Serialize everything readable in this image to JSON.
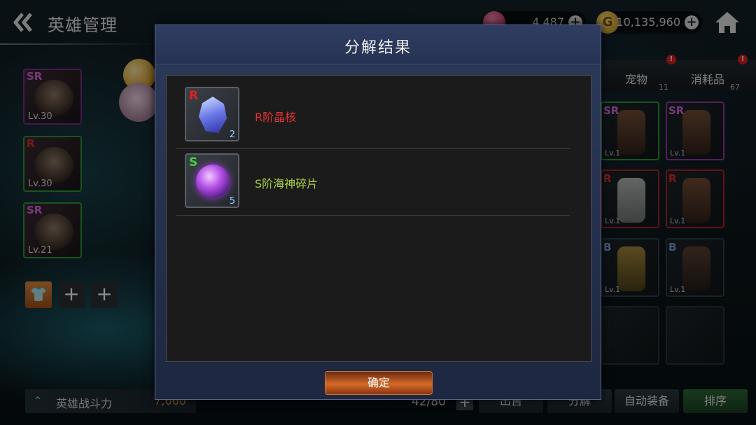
{
  "header": {
    "title": "英雄管理",
    "gems": "4,487",
    "gold": "10,135,960",
    "gold_icon_letter": "G"
  },
  "left_panel": {
    "heroes": [
      {
        "rarity": "SR",
        "level": "Lv.30"
      },
      {
        "rarity": "R",
        "level": "Lv.30"
      },
      {
        "rarity": "SR",
        "level": "Lv.21"
      }
    ],
    "equip_buttons": [
      "👕",
      "+",
      "+"
    ]
  },
  "inventory": {
    "tabs": [
      {
        "label": "宠物",
        "count": "11"
      },
      {
        "label": "消耗品",
        "count": "67"
      }
    ],
    "alert": "!",
    "items": [
      {
        "rarity": "SR",
        "level": "Lv.1"
      },
      {
        "rarity": "SR",
        "level": "Lv.1"
      },
      {
        "rarity": "R",
        "level": "Lv.1"
      },
      {
        "rarity": "R",
        "level": "Lv.1"
      },
      {
        "rarity": "B",
        "level": "Lv.1"
      },
      {
        "rarity": "B",
        "level": "Lv.1"
      }
    ]
  },
  "bottom_bar": {
    "power_label": "英雄战斗力",
    "power_value": "7,660",
    "bag_count": "42/80",
    "bag_plus": "+",
    "buttons": [
      "出售",
      "分解",
      "自动装备",
      "排序"
    ]
  },
  "dialog": {
    "title": "分解结果",
    "items": [
      {
        "rarity": "R",
        "name": "R阶晶核",
        "quantity": "2",
        "rarity_color": "#e02020",
        "name_color": "#e83030"
      },
      {
        "rarity": "S",
        "name": "S阶海神碎片",
        "quantity": "5",
        "rarity_color": "#40d040",
        "name_color": "#a8d040"
      }
    ],
    "confirm_label": "确定"
  }
}
